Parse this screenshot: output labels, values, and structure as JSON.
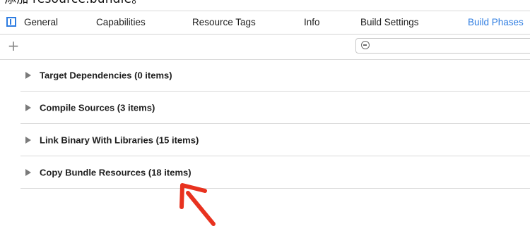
{
  "caption": {
    "text": "添加 resource.bundle。"
  },
  "tabs": [
    {
      "label": "General",
      "active": false
    },
    {
      "label": "Capabilities",
      "active": false
    },
    {
      "label": "Resource Tags",
      "active": false
    },
    {
      "label": "Info",
      "active": false
    },
    {
      "label": "Build Settings",
      "active": false
    },
    {
      "label": "Build Phases",
      "active": true
    }
  ],
  "toolbar": {
    "add_label": "+",
    "filter_placeholder": ""
  },
  "phases": [
    {
      "label": "Target Dependencies (0 items)"
    },
    {
      "label": "Compile Sources (3 items)"
    },
    {
      "label": "Link Binary With Libraries (15 items)"
    },
    {
      "label": "Copy Bundle Resources (18 items)"
    }
  ],
  "colors": {
    "accent": "#2f7de1",
    "annotation": "#e8321f",
    "disclosure": "#7a7a7a"
  },
  "icons": {
    "sidebar_toggle": "sidebar-toggle-icon",
    "add": "plus-icon",
    "filter": "filter-icon",
    "disclosure": "disclosure-triangle-icon",
    "annotation": "red-arrow-icon"
  }
}
